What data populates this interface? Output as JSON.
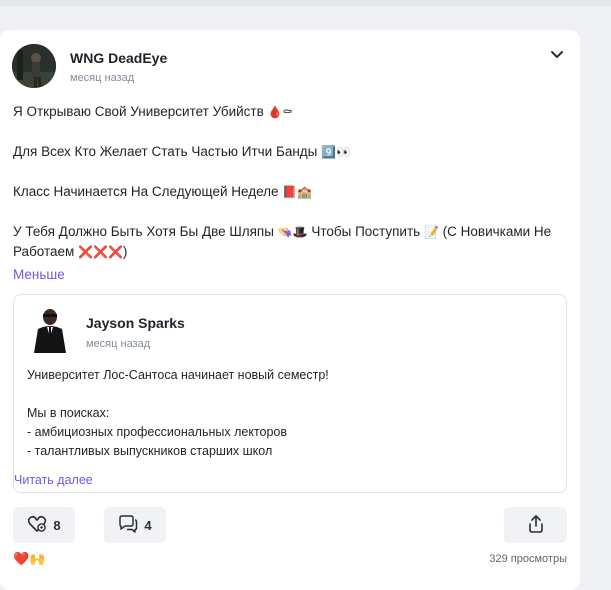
{
  "post": {
    "author_name": "WNG DeadEye",
    "time": "месяц назад",
    "lines": [
      {
        "text": "Я Открываю Свой Университет Убийств ",
        "emoji": "🩸⚰"
      },
      {
        "text": "Для Всех Кто Желает Стать Частью Итчи Банды ",
        "emoji": "9️⃣👀"
      },
      {
        "text": "Класс Начинается На Следующей Неделе ",
        "emoji": "📕🏫"
      },
      {
        "text": "У Тебя Должно Быть Хотя Бы Две Шляпы ",
        "emoji": "👒🎩",
        "text2": " Чтобы Поступить ",
        "emoji2": "📝",
        "text3": " (С Новичками Не Работаем ",
        "emoji3": "❌❌❌",
        "text4": ")"
      }
    ],
    "less_label": "Меньше"
  },
  "repost": {
    "author_name": "Jayson Sparks",
    "time": "месяц назад",
    "line1": "Университет Лос-Сантоса начинает новый семестр!",
    "line2": "Мы в поисках:",
    "line3": "- амбициозных профессиональных лекторов",
    "line4": "- талантливых выпускников старших школ",
    "read_more": "Читать далее"
  },
  "actions": {
    "likes_count": "8",
    "comments_count": "4"
  },
  "footer": {
    "reactions": "❤️🙌",
    "views": "329 просмотры"
  },
  "colors": {
    "accent": "#7357e5",
    "secondary_text": "#818c99"
  },
  "icons": [
    "chevron-down-icon",
    "reaction-heart-icon",
    "comment-icon",
    "share-icon"
  ]
}
